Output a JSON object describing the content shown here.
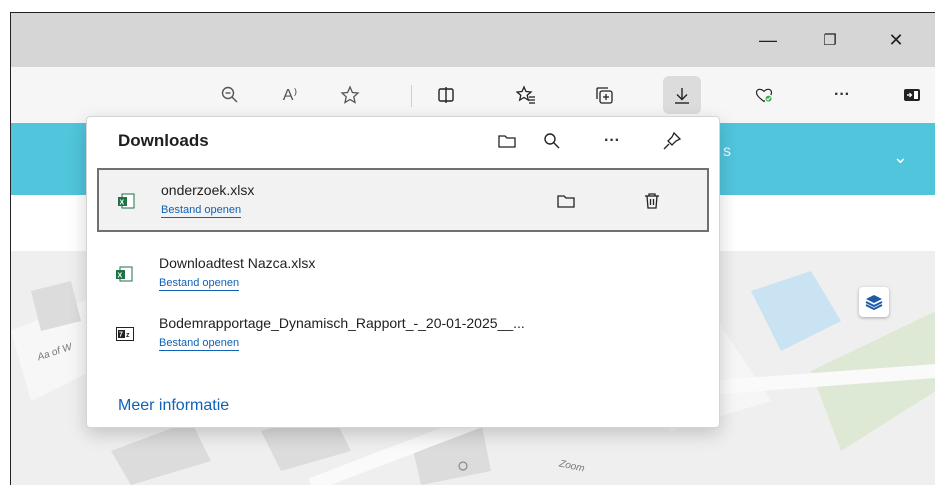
{
  "window": {
    "minimize_glyph": "—",
    "restore_glyph": "❐",
    "close_glyph": "✕"
  },
  "toolbar": {
    "icons": [
      "zoom-out-icon",
      "read-aloud-icon",
      "favorite-star-icon",
      "split-screen-icon",
      "favorites-list-icon",
      "collections-icon",
      "download-icon",
      "browser-essentials-icon",
      "more-icon",
      "sidebar-toggle-icon"
    ],
    "read_aloud_label": "A⁾",
    "more_label": "···"
  },
  "banner": {
    "partial_text": "s",
    "chevron": "⌄"
  },
  "map": {
    "street_label_1": "Aa of W",
    "street_label_2": "Zoom"
  },
  "downloads": {
    "title": "Downloads",
    "header_icons": [
      "folder-icon",
      "search-icon",
      "more-icon",
      "pin-icon"
    ],
    "more_label": "···",
    "items": [
      {
        "name": "onderzoek.xlsx",
        "action": "Bestand openen",
        "type": "excel",
        "selected": true
      },
      {
        "name": "Downloadtest Nazca.xlsx",
        "action": "Bestand openen",
        "type": "excel",
        "selected": false
      },
      {
        "name": "Bodemrapportage_Dynamisch_Rapport_-_20-01-2025__...",
        "action": "Bestand openen",
        "type": "7z",
        "selected": false
      }
    ],
    "more_info": "Meer informatie"
  },
  "colors": {
    "banner": "#50c5dc",
    "link": "#0f62b5",
    "titlebar": "#d6d6d6"
  }
}
